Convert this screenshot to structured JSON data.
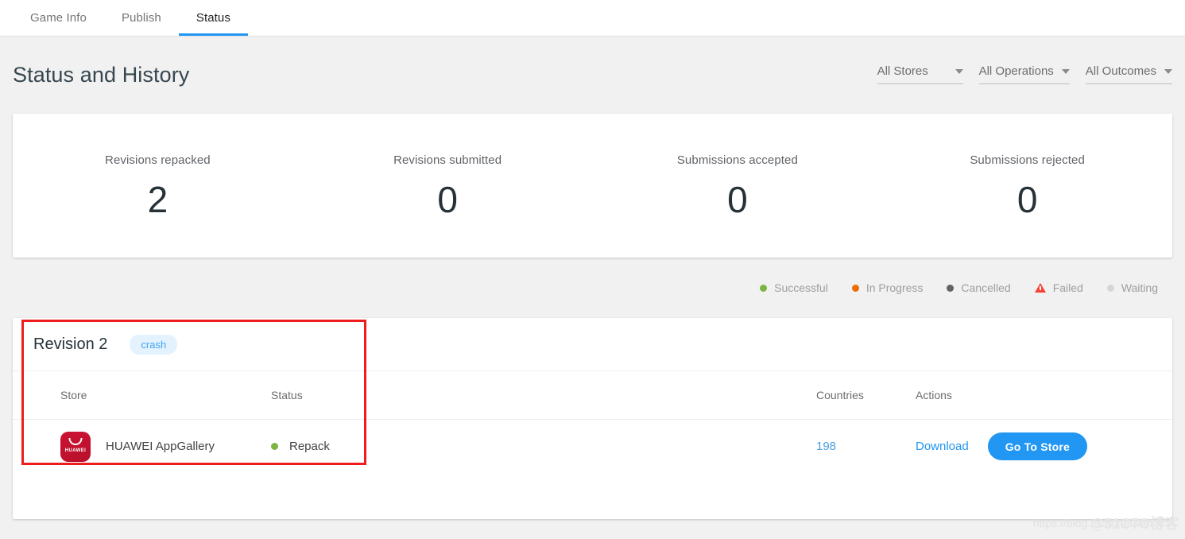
{
  "tabs": [
    {
      "label": "Game Info",
      "active": false
    },
    {
      "label": "Publish",
      "active": false
    },
    {
      "label": "Status",
      "active": true
    }
  ],
  "header": {
    "title": "Status and History",
    "filters": [
      {
        "label": "All Stores"
      },
      {
        "label": "All Operations"
      },
      {
        "label": "All Outcomes"
      }
    ]
  },
  "stats": [
    {
      "label": "Revisions repacked",
      "value": "2"
    },
    {
      "label": "Revisions submitted",
      "value": "0"
    },
    {
      "label": "Submissions accepted",
      "value": "0"
    },
    {
      "label": "Submissions rejected",
      "value": "0"
    }
  ],
  "legend": [
    {
      "label": "Successful",
      "color": "#7cb342",
      "type": "dot"
    },
    {
      "label": "In Progress",
      "color": "#ef6c00",
      "type": "dot"
    },
    {
      "label": "Cancelled",
      "color": "#5f6368",
      "type": "dot"
    },
    {
      "label": "Failed",
      "color": "#f44336",
      "type": "triangle"
    },
    {
      "label": "Waiting",
      "color": "#d6d6d6",
      "type": "dot"
    }
  ],
  "revision": {
    "title": "Revision 2",
    "badge": "crash",
    "columns": {
      "store": "Store",
      "status": "Status",
      "countries": "Countries",
      "actions": "Actions"
    },
    "rows": [
      {
        "store_name": "HUAWEI AppGallery",
        "store_icon_label": "HUAWEI",
        "status": "Repack",
        "status_color": "#7cb342",
        "countries": "198",
        "download_label": "Download",
        "go_to_store_label": "Go To Store"
      }
    ]
  },
  "watermark": {
    "url": "https://blog.csdn.net/wei_",
    "overlay": "@51CTO博客"
  },
  "colors": {
    "accent": "#2196f3",
    "badge_bg": "#e3f2fd",
    "badge_text": "#42a5f5",
    "annotation": "#ee1c1c",
    "huawei_red": "#c8102e"
  }
}
